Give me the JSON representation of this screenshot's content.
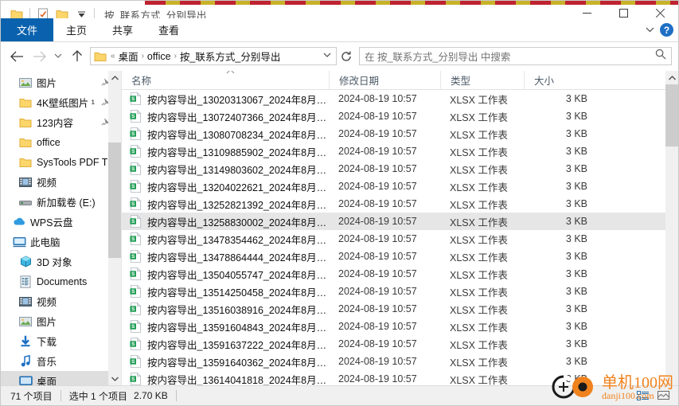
{
  "window": {
    "title": "按_联系方式_分别导出",
    "quick_access": [
      "folder-icon",
      "properties-icon",
      "new-folder-icon",
      "customize-dropdown-icon"
    ],
    "controls": {
      "minimize": "—",
      "maximize": "□",
      "close": "✕"
    }
  },
  "ribbon": {
    "tabs": [
      {
        "id": "file",
        "label": "文件",
        "active": true
      },
      {
        "id": "home",
        "label": "主页",
        "active": false
      },
      {
        "id": "share",
        "label": "共享",
        "active": false
      },
      {
        "id": "view",
        "label": "查看",
        "active": false
      }
    ],
    "expand_label": "⌄",
    "help_label": "?"
  },
  "address": {
    "back": "←",
    "forward": "→",
    "recent": "⌄",
    "up": "↑",
    "breadcrumb_overflow": "«",
    "breadcrumbs": [
      "桌面",
      "office",
      "按_联系方式_分别导出"
    ],
    "separator": "›",
    "dropdown_caret": "⌄",
    "refresh": "↻",
    "search_placeholder": "在 按_联系方式_分别导出 中搜索",
    "search_value": "",
    "search_icon": "⚲"
  },
  "sidebar": {
    "items": [
      {
        "label": "图片",
        "icon": "pictures-icon",
        "indent": 1,
        "pinned": true,
        "selected": false
      },
      {
        "label": "4K壁纸图片 ¹",
        "icon": "folder-icon",
        "indent": 1,
        "pinned": true,
        "selected": false
      },
      {
        "label": "123内容",
        "icon": "folder-icon",
        "indent": 1,
        "pinned": true,
        "selected": false
      },
      {
        "label": "office",
        "icon": "folder-icon",
        "indent": 1,
        "pinned": false,
        "selected": false
      },
      {
        "label": "SysTools PDF T",
        "icon": "folder-icon",
        "indent": 1,
        "pinned": false,
        "selected": false
      },
      {
        "label": "视频",
        "icon": "videos-icon",
        "indent": 1,
        "pinned": false,
        "selected": false
      },
      {
        "label": "新加载卷 (E:)",
        "icon": "drive-icon",
        "indent": 1,
        "pinned": false,
        "selected": false
      },
      {
        "label": "WPS云盘",
        "icon": "cloud-icon",
        "indent": 0,
        "pinned": false,
        "selected": false
      },
      {
        "label": "此电脑",
        "icon": "pc-icon",
        "indent": 0,
        "pinned": false,
        "selected": false
      },
      {
        "label": "3D 对象",
        "icon": "3d-icon",
        "indent": 1,
        "pinned": false,
        "selected": false
      },
      {
        "label": "Documents",
        "icon": "documents-icon",
        "indent": 1,
        "pinned": false,
        "selected": false
      },
      {
        "label": "视频",
        "icon": "videos-icon",
        "indent": 1,
        "pinned": false,
        "selected": false
      },
      {
        "label": "图片",
        "icon": "pictures-icon",
        "indent": 1,
        "pinned": false,
        "selected": false
      },
      {
        "label": "下载",
        "icon": "downloads-icon",
        "indent": 1,
        "pinned": false,
        "selected": false
      },
      {
        "label": "音乐",
        "icon": "music-icon",
        "indent": 1,
        "pinned": false,
        "selected": false
      },
      {
        "label": "桌面",
        "icon": "desktop-icon",
        "indent": 1,
        "pinned": false,
        "selected": true
      }
    ],
    "scroll": {
      "up_arrow": "⌃",
      "down_arrow": "⌄",
      "thumb_top_pct": 20,
      "thumb_height_pct": 40
    }
  },
  "columns": {
    "name": "名称",
    "date": "修改日期",
    "type": "类型",
    "size": "大小",
    "sort_indicator": "⌃"
  },
  "files": [
    {
      "name": "按内容导出_13020313067_2024年8月1...",
      "date": "2024-08-19 10:57",
      "type": "XLSX 工作表",
      "size": "3 KB",
      "selected": false
    },
    {
      "name": "按内容导出_13072407366_2024年8月1...",
      "date": "2024-08-19 10:57",
      "type": "XLSX 工作表",
      "size": "3 KB",
      "selected": false
    },
    {
      "name": "按内容导出_13080708234_2024年8月1...",
      "date": "2024-08-19 10:57",
      "type": "XLSX 工作表",
      "size": "3 KB",
      "selected": false
    },
    {
      "name": "按内容导出_13109885902_2024年8月1...",
      "date": "2024-08-19 10:57",
      "type": "XLSX 工作表",
      "size": "3 KB",
      "selected": false
    },
    {
      "name": "按内容导出_13149803602_2024年8月1...",
      "date": "2024-08-19 10:57",
      "type": "XLSX 工作表",
      "size": "3 KB",
      "selected": false
    },
    {
      "name": "按内容导出_13204022621_2024年8月1...",
      "date": "2024-08-19 10:57",
      "type": "XLSX 工作表",
      "size": "3 KB",
      "selected": false
    },
    {
      "name": "按内容导出_13252821392_2024年8月1...",
      "date": "2024-08-19 10:57",
      "type": "XLSX 工作表",
      "size": "3 KB",
      "selected": false
    },
    {
      "name": "按内容导出_13258830002_2024年8月1...",
      "date": "2024-08-19 10:57",
      "type": "XLSX 工作表",
      "size": "3 KB",
      "selected": true
    },
    {
      "name": "按内容导出_13478354462_2024年8月1...",
      "date": "2024-08-19 10:57",
      "type": "XLSX 工作表",
      "size": "3 KB",
      "selected": false
    },
    {
      "name": "按内容导出_13478864444_2024年8月1...",
      "date": "2024-08-19 10:57",
      "type": "XLSX 工作表",
      "size": "3 KB",
      "selected": false
    },
    {
      "name": "按内容导出_13504055747_2024年8月1...",
      "date": "2024-08-19 10:57",
      "type": "XLSX 工作表",
      "size": "3 KB",
      "selected": false
    },
    {
      "name": "按内容导出_13514250458_2024年8月1...",
      "date": "2024-08-19 10:57",
      "type": "XLSX 工作表",
      "size": "3 KB",
      "selected": false
    },
    {
      "name": "按内容导出_13516038916_2024年8月1...",
      "date": "2024-08-19 10:57",
      "type": "XLSX 工作表",
      "size": "3 KB",
      "selected": false
    },
    {
      "name": "按内容导出_13591604843_2024年8月1...",
      "date": "2024-08-19 10:57",
      "type": "XLSX 工作表",
      "size": "3 KB",
      "selected": false
    },
    {
      "name": "按内容导出_13591637222_2024年8月1...",
      "date": "2024-08-19 10:57",
      "type": "XLSX 工作表",
      "size": "3 KB",
      "selected": false
    },
    {
      "name": "按内容导出_13591640362_2024年8月1...",
      "date": "2024-08-19 10:57",
      "type": "XLSX 工作表",
      "size": "3 KB",
      "selected": false
    },
    {
      "name": "按内容导出_13614041818_2024年8月1...",
      "date": "2024-08-19 10:57",
      "type": "XLSX 工作表",
      "size": "3 KB",
      "selected": false
    }
  ],
  "file_scroll": {
    "thumb_top_pct": 0,
    "thumb_height_pct": 22
  },
  "status": {
    "item_count": "71 个项目",
    "selection": "选中 1 个项目",
    "selection_size": "2.70 KB"
  },
  "watermark": {
    "main": "单机100网",
    "sub": "danji100.com",
    "color": "#f0821e"
  },
  "colors": {
    "accent": "#0a62ae",
    "selection": "#e6e6e6",
    "excel_green": "#1fa martin"
  }
}
